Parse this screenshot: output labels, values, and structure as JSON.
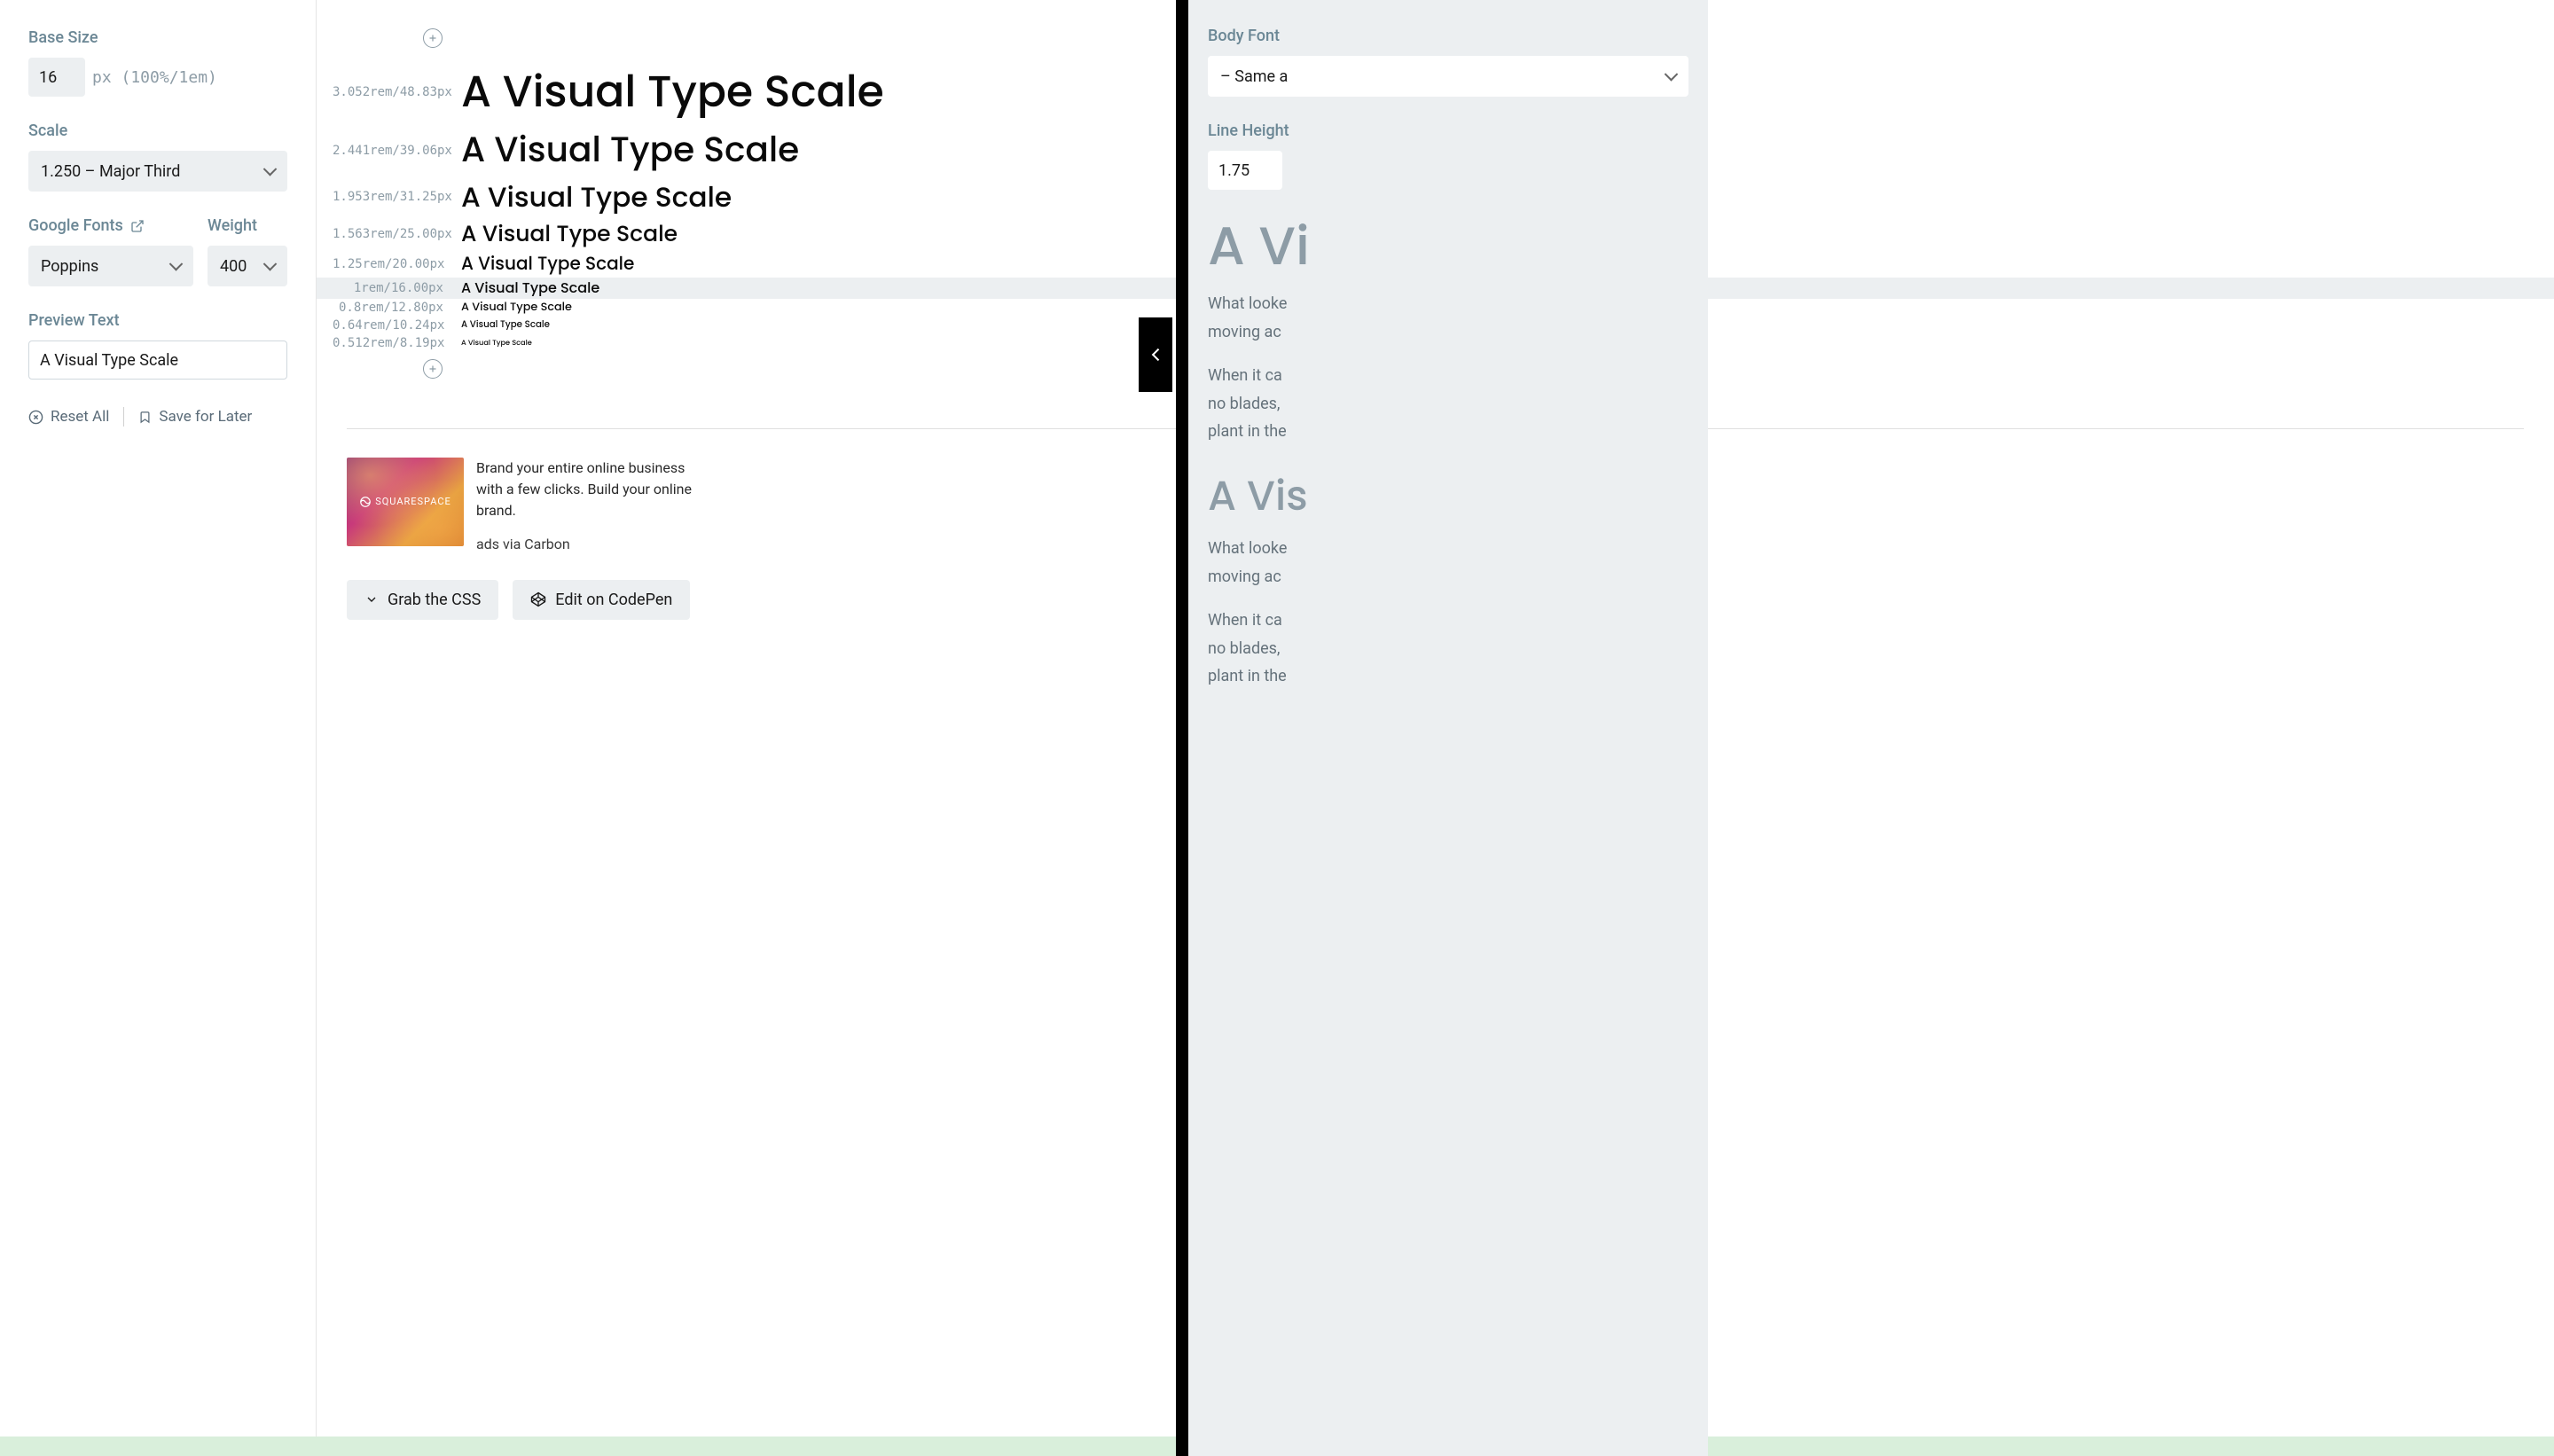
{
  "sidebar": {
    "base_label": "Base Size",
    "base_value": "16",
    "base_unit_hint": "px (100%/1em)",
    "scale_label": "Scale",
    "scale_value": "1.250 – Major Third",
    "fonts_label": "Google Fonts",
    "fonts_value": "Poppins",
    "weight_label": "Weight",
    "weight_value": "400",
    "preview_label": "Preview Text",
    "preview_value": "A Visual Type Scale",
    "reset_label": "Reset All",
    "save_label": "Save for Later"
  },
  "scale_rows": [
    {
      "meta": "3.052rem/48.83px",
      "px": 48.83,
      "current": false
    },
    {
      "meta": "2.441rem/39.06px",
      "px": 39.06,
      "current": false
    },
    {
      "meta": "1.953rem/31.25px",
      "px": 31.25,
      "current": false
    },
    {
      "meta": "1.563rem/25.00px",
      "px": 25.0,
      "current": false
    },
    {
      "meta": "1.25rem/20.00px",
      "px": 20.0,
      "current": false
    },
    {
      "meta": "1rem/16.00px",
      "px": 16.0,
      "current": true
    },
    {
      "meta": "0.8rem/12.80px",
      "px": 12.8,
      "current": false
    },
    {
      "meta": "0.64rem/10.24px",
      "px": 10.24,
      "current": false
    },
    {
      "meta": "0.512rem/8.19px",
      "px": 8.19,
      "current": false
    }
  ],
  "sample_text": "A Visual Type Scale",
  "ad": {
    "brand": "SQUARESPACE",
    "copy": "Brand your entire online business with a few clicks. Build your online brand.",
    "via": "ads via Carbon"
  },
  "cta": {
    "grab": "Grab the CSS",
    "codepen": "Edit on CodePen"
  },
  "drawer": {
    "body_font_label": "Body Font",
    "body_font_value": "– Same a",
    "line_height_label": "Line Height",
    "line_height_value": "1.75",
    "heading1": "A Vi",
    "heading2": "A Vis",
    "p1a": "What looke",
    "p1b": "moving ac",
    "p2a": "When it ca",
    "p2b": "no blades,",
    "p2c": "plant in the"
  }
}
